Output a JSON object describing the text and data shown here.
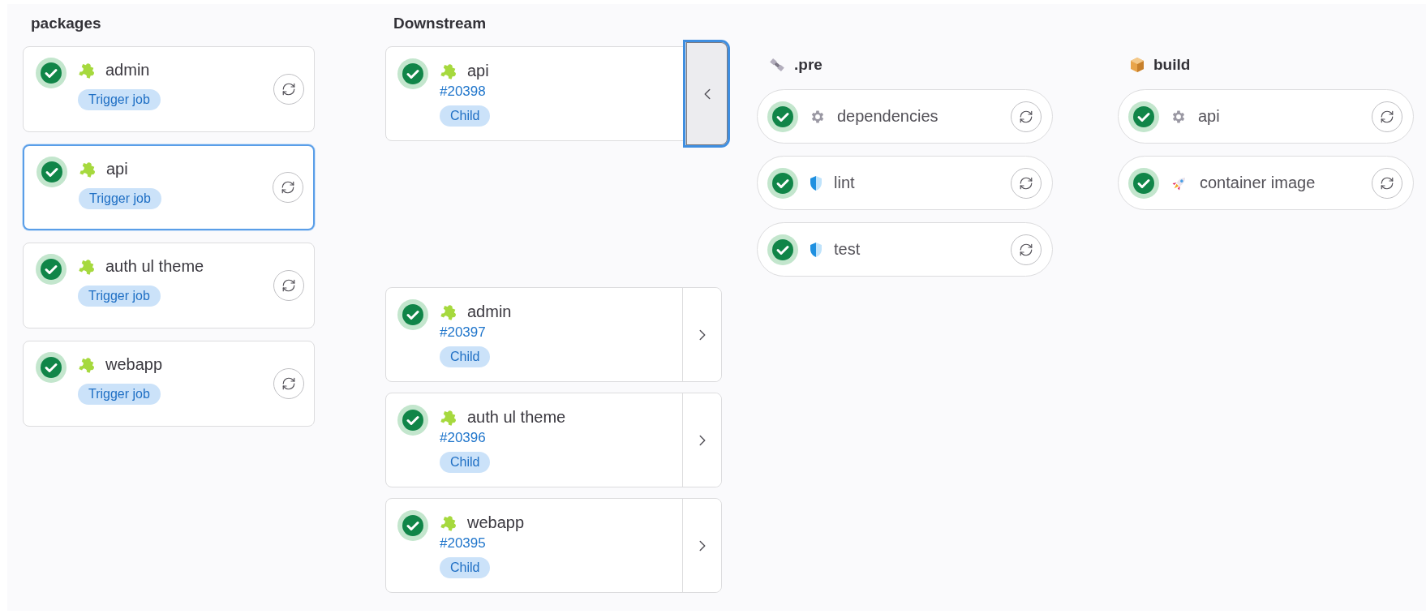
{
  "packages": {
    "title": "packages",
    "items": [
      {
        "name": "admin",
        "passed": true,
        "kind": "puzzle",
        "badge": "Trigger job",
        "highlighted": false
      },
      {
        "name": "api",
        "passed": true,
        "kind": "puzzle",
        "badge": "Trigger job",
        "highlighted": true
      },
      {
        "name": "auth ul theme",
        "passed": true,
        "kind": "puzzle",
        "badge": "Trigger job",
        "highlighted": false
      },
      {
        "name": "webapp",
        "passed": true,
        "kind": "puzzle",
        "badge": "Trigger job",
        "highlighted": false
      }
    ]
  },
  "downstream": {
    "title": "Downstream",
    "items": [
      {
        "name": "api",
        "passed": true,
        "kind": "puzzle",
        "link": "#20398",
        "badge": "Child",
        "expanded": true,
        "stages": [
          {
            "name": ".pre",
            "kind": "satellite",
            "jobs": [
              {
                "name": "dependencies",
                "passed": true,
                "kind": "gear"
              },
              {
                "name": "lint",
                "passed": true,
                "kind": "shield"
              },
              {
                "name": "test",
                "passed": true,
                "kind": "shield"
              }
            ]
          },
          {
            "name": "build",
            "kind": "package",
            "jobs": [
              {
                "name": "api",
                "passed": true,
                "kind": "gear"
              },
              {
                "name": "container image",
                "passed": true,
                "kind": "rocket"
              }
            ]
          }
        ]
      },
      {
        "name": "admin",
        "passed": true,
        "kind": "puzzle",
        "link": "#20397",
        "badge": "Child",
        "expanded": false
      },
      {
        "name": "auth ul theme",
        "passed": true,
        "kind": "puzzle",
        "link": "#20396",
        "badge": "Child",
        "expanded": false
      },
      {
        "name": "webapp",
        "passed": true,
        "kind": "puzzle",
        "link": "#20395",
        "badge": "Child",
        "expanded": false
      }
    ]
  }
}
